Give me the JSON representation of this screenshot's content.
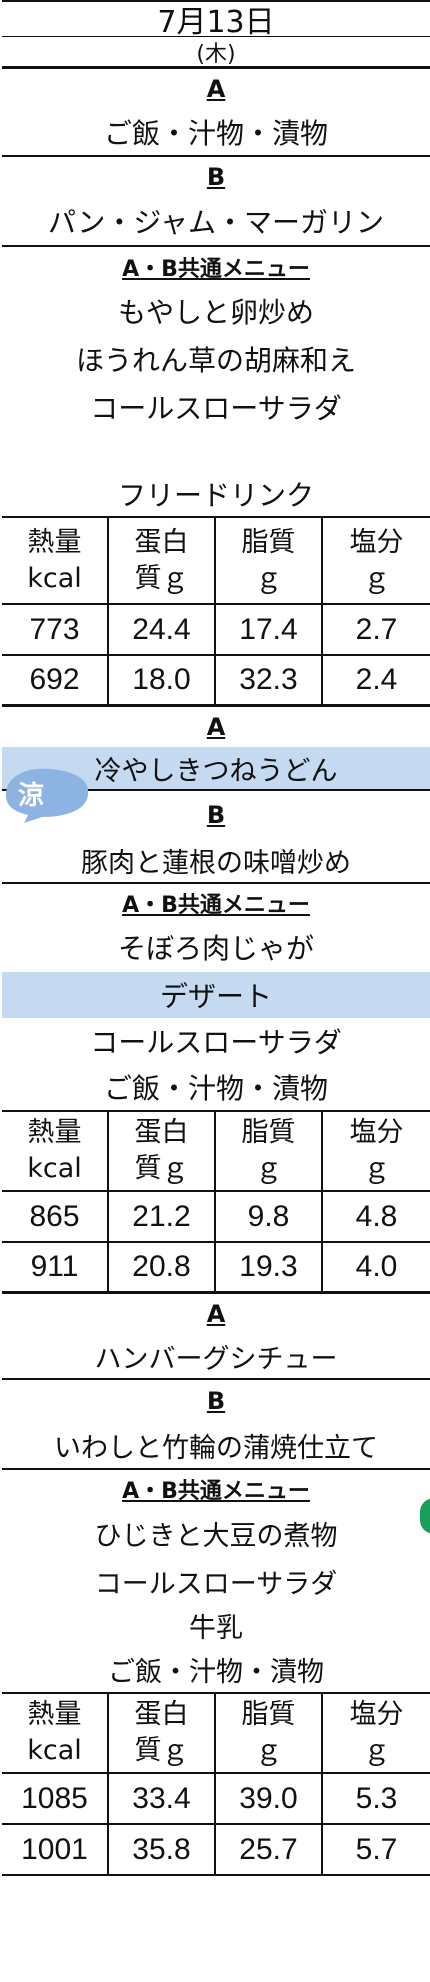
{
  "date": "7月13日",
  "weekday": "(木)",
  "colors": {
    "highlight": "#c5d9f1",
    "badge": "#8db3e2",
    "green_marker": "#17a05a"
  },
  "nutrition_headers": [
    "熱量\nkcal",
    "蛋白\n質ｇ",
    "脂質\nｇ",
    "塩分\nｇ"
  ],
  "day1": {
    "a_label": "A",
    "a_item": "ご飯・汁物・漬物",
    "b_label": "B",
    "b_item": "パン・ジャム・マーガリン",
    "common_label": "A・B共通メニュー",
    "common_items": [
      "もやしと卵炒め",
      "ほうれん草の胡麻和え",
      "コールスローサラダ"
    ],
    "drink": "フリードリンク",
    "values": [
      [
        "773",
        "24.4",
        "17.4",
        "2.7"
      ],
      [
        "692",
        "18.0",
        "32.3",
        "2.4"
      ]
    ]
  },
  "day2": {
    "badge": "涼",
    "a_label": "A",
    "a_item": "冷やしきつねうどん",
    "b_label": "B",
    "b_item": "豚肉と蓮根の味噌炒め",
    "common_label": "A・B共通メニュー",
    "common_items": [
      "そぼろ肉じゃが",
      "デザート",
      "コールスローサラダ",
      "ご飯・汁物・漬物"
    ],
    "values": [
      [
        "865",
        "21.2",
        "9.8",
        "4.8"
      ],
      [
        "911",
        "20.8",
        "19.3",
        "4.0"
      ]
    ]
  },
  "day3": {
    "a_label": "A",
    "a_item": "ハンバーグシチュー",
    "b_label": "B",
    "b_item": "いわしと竹輪の蒲焼仕立て",
    "common_label": "A・B共通メニュー",
    "common_items": [
      "ひじきと大豆の煮物",
      "コールスローサラダ",
      "牛乳",
      "ご飯・汁物・漬物"
    ],
    "values": [
      [
        "1085",
        "33.4",
        "39.0",
        "5.3"
      ],
      [
        "1001",
        "35.8",
        "25.7",
        "5.7"
      ]
    ]
  }
}
